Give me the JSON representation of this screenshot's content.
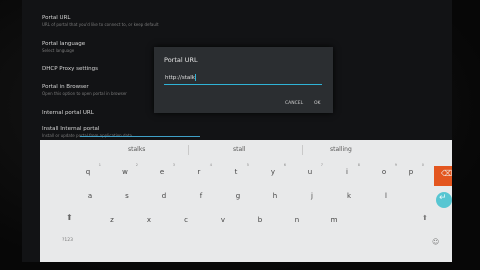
{
  "settings": [
    {
      "title": "Portal URL",
      "summary": "URL of portal that you'd like to connect to, or keep default"
    },
    {
      "title": "Portal language",
      "summary": "Select language"
    },
    {
      "title": "DHCP Proxy settings",
      "summary": ""
    },
    {
      "title": "Portal in Browser",
      "summary": "Open this option to open portal in browser"
    },
    {
      "title": "Internal portal URL",
      "summary": ""
    },
    {
      "title": "Install Internal portal",
      "summary": "Install or update portal from application data"
    }
  ],
  "dialog": {
    "title": "Portal URL",
    "input_value": "http://stalk",
    "cancel_label": "CANCEL",
    "ok_label": "OK"
  },
  "keyboard": {
    "suggestions": [
      "stalks",
      "stall",
      "stalling"
    ],
    "row1": [
      {
        "key": "q",
        "hint": "1"
      },
      {
        "key": "w",
        "hint": "2"
      },
      {
        "key": "e",
        "hint": "3"
      },
      {
        "key": "r",
        "hint": "4"
      },
      {
        "key": "t",
        "hint": "5"
      },
      {
        "key": "y",
        "hint": "6"
      },
      {
        "key": "u",
        "hint": "7"
      },
      {
        "key": "i",
        "hint": "8"
      },
      {
        "key": "o",
        "hint": "9"
      },
      {
        "key": "p",
        "hint": "0"
      }
    ],
    "row2": [
      "a",
      "s",
      "d",
      "f",
      "g",
      "h",
      "j",
      "k",
      "l"
    ],
    "row3": [
      "z",
      "x",
      "c",
      "v",
      "b",
      "n",
      "m"
    ],
    "shift_glyph": "⬆",
    "symbols_label": "?123",
    "backspace_glyph": "⌫",
    "enter_glyph": "↵",
    "grid_glyph": "☺",
    "accent_color": "#e3561f",
    "enter_color": "#58c6d2"
  }
}
